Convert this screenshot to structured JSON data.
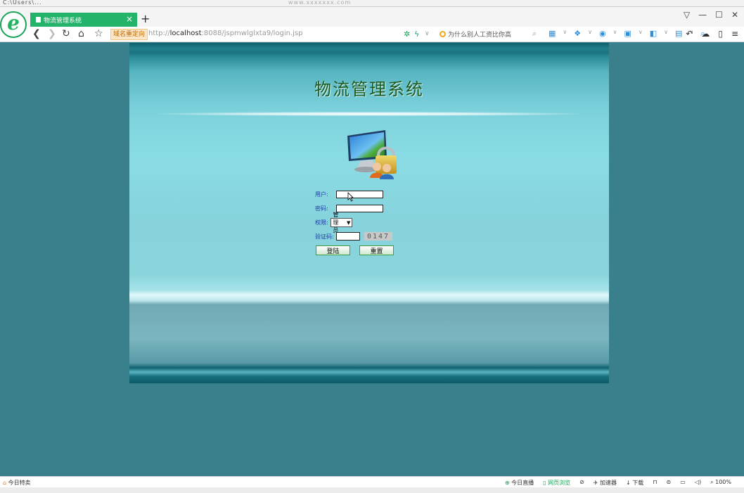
{
  "window": {
    "os_title": "C:\\Users\\...",
    "blurred_url": "www.xxxxxxx.com"
  },
  "browser": {
    "tab_title": "物流管理系统",
    "new_tab_symbol": "+",
    "tab_close_symbol": "×",
    "domain_tag": "域名重定向",
    "url_scheme": "http://",
    "url_host": "localhost",
    "url_rest": ":8088/jspmwlglxta9/login.jsp",
    "search_text": "为什么别人工资比你高",
    "win_controls": [
      "▽",
      "—",
      "☐",
      "✕"
    ],
    "extensions": [
      "▦",
      "∨",
      "❖",
      "∨",
      "◉",
      "∨",
      "▣",
      "∨",
      "◧",
      "∨",
      "▤",
      "∨",
      "⌕"
    ],
    "right_icons": [
      "↶",
      "☁",
      "▯",
      "≡"
    ]
  },
  "page": {
    "title": "物流管理系统",
    "form": {
      "username_label": "用户:",
      "password_label": "密码:",
      "role_label": "权限:",
      "role_value": "管理员",
      "captcha_label": "验证码:",
      "captcha_value": "0147",
      "login_label": "登陆",
      "reset_label": "重置"
    }
  },
  "statusbar": {
    "left": "今日特卖",
    "items": [
      "今日直播",
      "网页浏览",
      "⊘",
      "加速器",
      "下载",
      "⊓",
      "⊜",
      "▭",
      "◁)",
      "100%"
    ]
  },
  "colors": {
    "background": "#3a7f8c",
    "tab_active": "#24b36a",
    "title_text": "#1b5a1f",
    "label_text": "#1f3aa8"
  }
}
